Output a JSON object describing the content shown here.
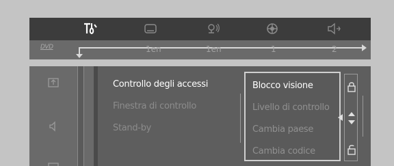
{
  "top_menu": {
    "icons": [
      {
        "name": "settings-tools-icon",
        "active": true
      },
      {
        "name": "subtitle-icon",
        "active": false
      },
      {
        "name": "audio-language-icon",
        "active": false
      },
      {
        "name": "angle-icon",
        "active": false
      },
      {
        "name": "speaker-icon",
        "active": false
      }
    ]
  },
  "status_bar": {
    "logo": "DVD",
    "values": [
      "1en",
      "1en",
      "1",
      "2"
    ]
  },
  "main_menu": {
    "items": [
      {
        "label": "Controllo degli accessi",
        "selected": true
      },
      {
        "label": "Finestra di controllo",
        "selected": false
      },
      {
        "label": "Stand-by",
        "selected": false
      }
    ]
  },
  "submenu": {
    "items": [
      {
        "label": "Blocco visione",
        "selected": true
      },
      {
        "label": "Livello di controllo",
        "selected": false
      },
      {
        "label": "Cambia paese",
        "selected": false
      },
      {
        "label": "Cambia codice",
        "selected": false
      }
    ]
  },
  "colors": {
    "background": "#c4c4c4",
    "topbar": "#3c3c3c",
    "panel": "#5e5e5e",
    "selected_text": "#ffffff",
    "dim_text": "#8c8c8c"
  }
}
